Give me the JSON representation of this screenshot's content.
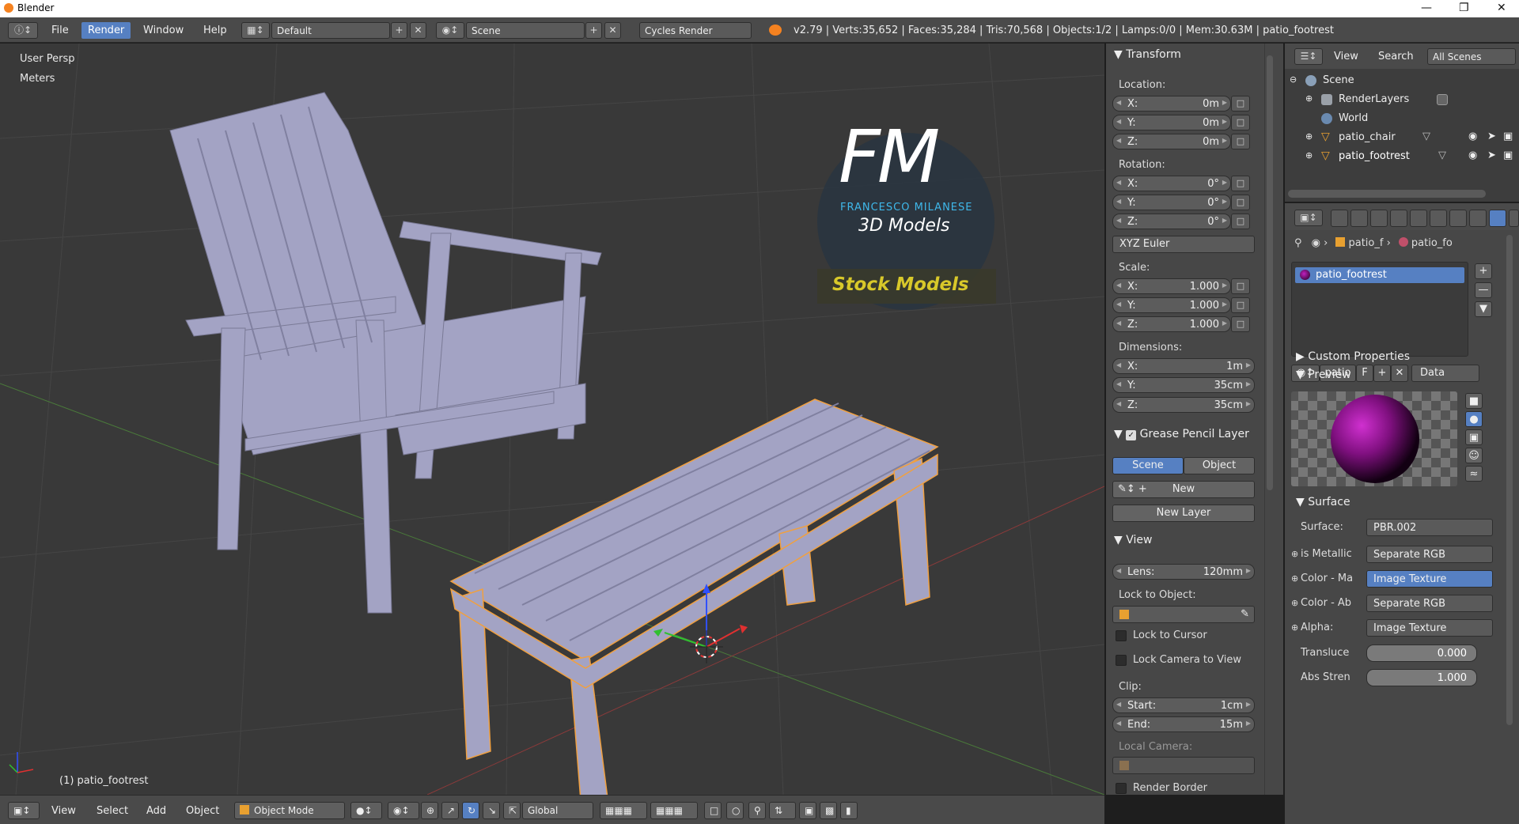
{
  "window": {
    "title": "Blender"
  },
  "menubar": {
    "file": "File",
    "render": "Render",
    "window": "Window",
    "help": "Help",
    "layout": "Default",
    "scene": "Scene",
    "engine": "Cycles Render",
    "stats": "v2.79 | Verts:35,652 | Faces:35,284 | Tris:70,568 | Objects:1/2 | Lamps:0/0 | Mem:30.63M | patio_footrest"
  },
  "viewport": {
    "view_name": "User Persp",
    "units": "Meters",
    "selected_object": "(1) patio_footrest",
    "watermark": {
      "initials": "FM",
      "name": "FRANCESCO MILANESE",
      "subtitle": "3D Models",
      "badge": "Stock Models"
    }
  },
  "viewport_header": {
    "view": "View",
    "select": "Select",
    "add": "Add",
    "object": "Object",
    "mode": "Object Mode",
    "orientation": "Global"
  },
  "npanel": {
    "transform": {
      "title": "Transform",
      "location_label": "Location:",
      "location": {
        "x": "0m",
        "y": "0m",
        "z": "0m"
      },
      "rotation_label": "Rotation:",
      "rotation": {
        "x": "0°",
        "y": "0°",
        "z": "0°"
      },
      "rotation_mode": "XYZ Euler",
      "scale_label": "Scale:",
      "scale": {
        "x": "1.000",
        "y": "1.000",
        "z": "1.000"
      },
      "dimensions_label": "Dimensions:",
      "dimensions": {
        "x": "1m",
        "y": "35cm",
        "z": "35cm"
      },
      "axis_x": "X:",
      "axis_y": "Y:",
      "axis_z": "Z:"
    },
    "grease_pencil": {
      "title": "Grease Pencil Layer",
      "scene": "Scene",
      "object": "Object",
      "new": "New",
      "new_layer": "New Layer"
    },
    "view": {
      "title": "View",
      "lens_label": "Lens:",
      "lens": "120mm",
      "lock_object": "Lock to Object:",
      "lock_cursor": "Lock to Cursor",
      "lock_camera": "Lock Camera to View",
      "clip": "Clip:",
      "start_label": "Start:",
      "start": "1cm",
      "end_label": "End:",
      "end": "15m",
      "local_camera": "Local Camera:",
      "render_border": "Render Border"
    }
  },
  "outliner": {
    "view": "View",
    "search": "Search",
    "filter": "All Scenes",
    "items": [
      {
        "label": "Scene"
      },
      {
        "label": "RenderLayers"
      },
      {
        "label": "World"
      },
      {
        "label": "patio_chair"
      },
      {
        "label": "patio_footrest"
      }
    ]
  },
  "properties": {
    "breadcrumb_obj": "patio_f",
    "breadcrumb_mat": "patio_fo",
    "material_slot": "patio_footrest",
    "material_name": "patio",
    "fake_user": "F",
    "link": "Data",
    "custom_props": "Custom Properties",
    "preview": "Preview",
    "surface_title": "Surface",
    "surface_label": "Surface:",
    "surface_value": "PBR.002",
    "inputs": [
      {
        "label": "is Metallic",
        "value": "Separate RGB"
      },
      {
        "label": "Color - Ma",
        "value": "Image Texture"
      },
      {
        "label": "Color - Ab",
        "value": "Separate RGB"
      },
      {
        "label": "Alpha:",
        "value": "Image Texture"
      }
    ],
    "translucence_label": "Transluce",
    "translucence": "0.000",
    "abs_label": "Abs Stren",
    "abs": "1.000"
  }
}
